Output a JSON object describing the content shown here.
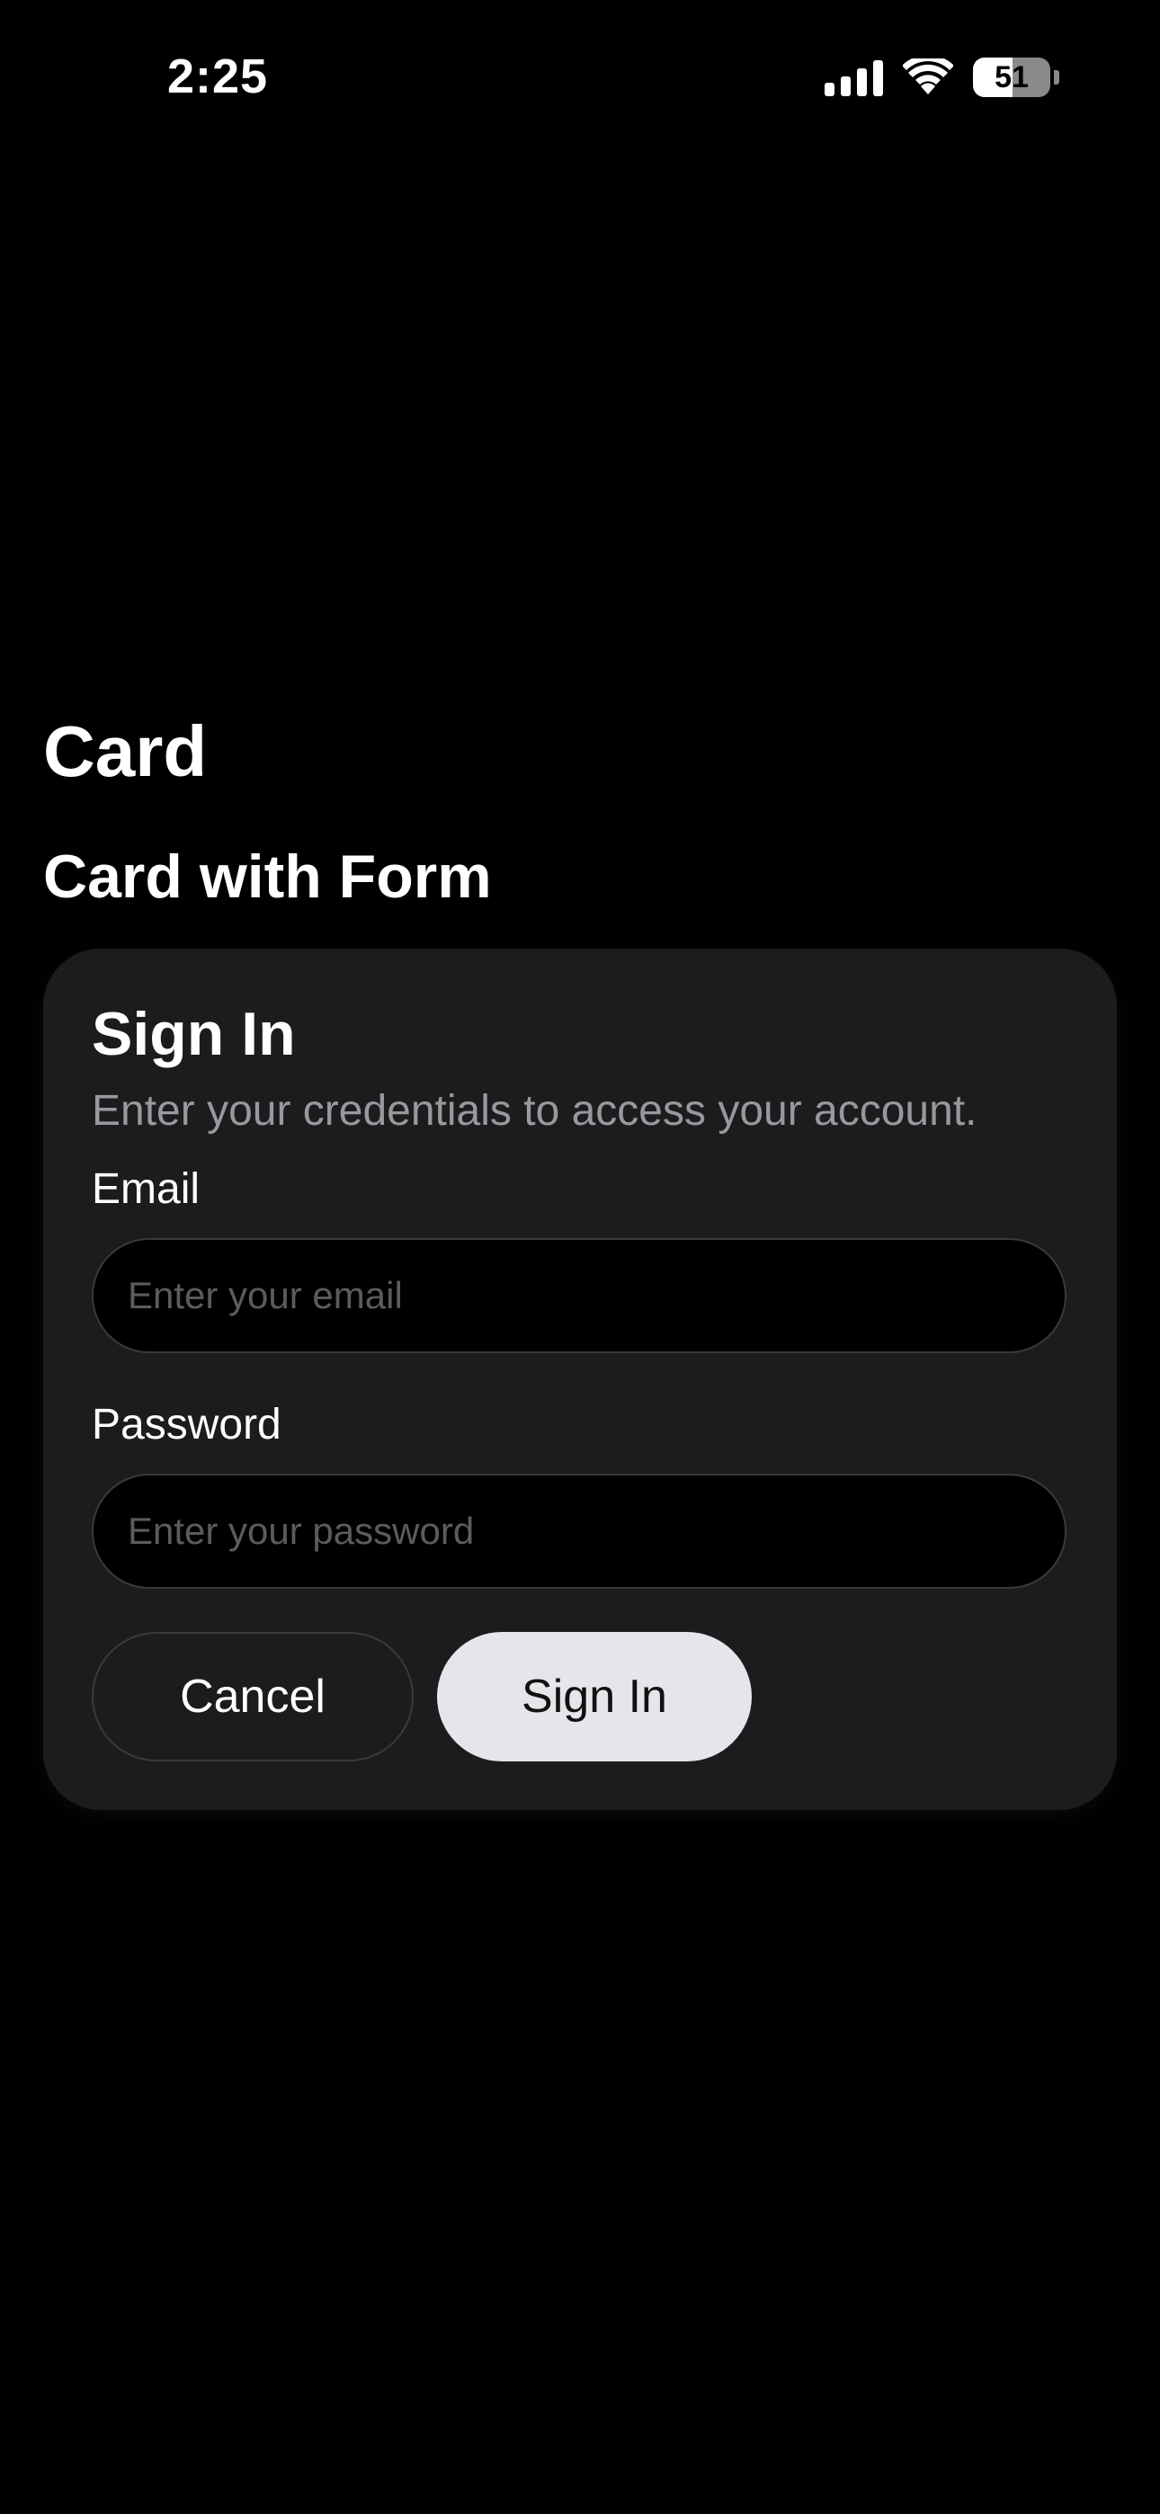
{
  "status_bar": {
    "time": "2:25",
    "battery_level": "51",
    "battery_fraction": 0.51,
    "icons": [
      "signal-icon",
      "wifi-icon",
      "battery-icon"
    ]
  },
  "page": {
    "title": "Card",
    "section_title": "Card with Form"
  },
  "card": {
    "title": "Sign In",
    "description": "Enter your credentials to access your account.",
    "email": {
      "label": "Email",
      "placeholder": "Enter your email",
      "value": ""
    },
    "password": {
      "label": "Password",
      "placeholder": "Enter your password",
      "value": ""
    },
    "cancel_label": "Cancel",
    "submit_label": "Sign In"
  },
  "colors": {
    "background": "#000000",
    "card": "#1c1c1e",
    "primary_button": "#e5e5ea",
    "muted_text": "#98989d",
    "border": "#3a3a3c"
  }
}
